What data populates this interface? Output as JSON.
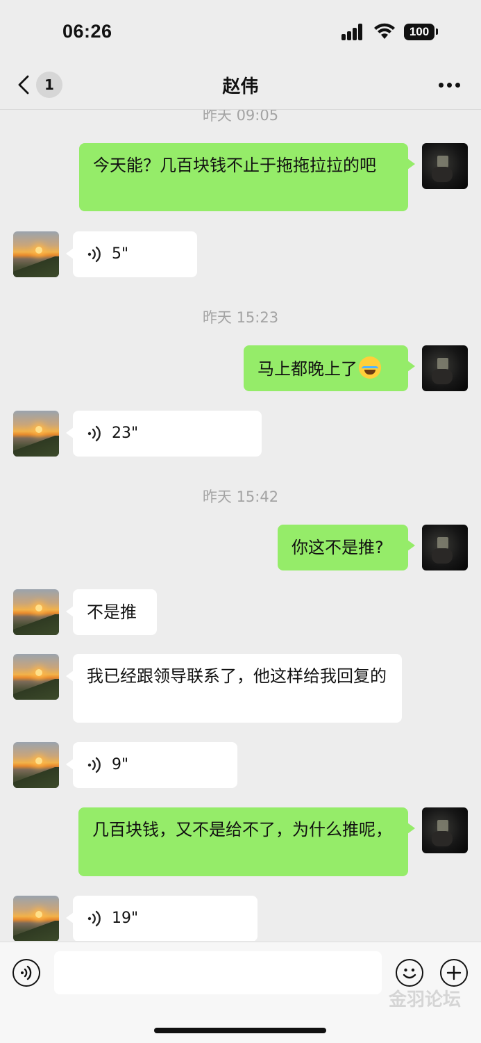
{
  "status_bar": {
    "time": "06:26",
    "battery": "100"
  },
  "nav": {
    "unread_count": "1",
    "title": "赵伟"
  },
  "timestamps": [
    "昨天 09:05",
    "昨天 15:23",
    "昨天 15:42"
  ],
  "messages": [
    {
      "side": "me",
      "type": "text",
      "text": "今天能？几百块钱不止于拖拖拉拉的吧"
    },
    {
      "side": "them",
      "type": "voice",
      "duration": "5\""
    },
    {
      "side": "me",
      "type": "text",
      "text": "马上都晚上了",
      "emoji": "laughing-tears"
    },
    {
      "side": "them",
      "type": "voice",
      "duration": "23\""
    },
    {
      "side": "me",
      "type": "text",
      "text": "你这不是推?"
    },
    {
      "side": "them",
      "type": "text",
      "text": "不是推"
    },
    {
      "side": "them",
      "type": "text",
      "text": "我已经跟领导联系了，他这样给我回复的"
    },
    {
      "side": "them",
      "type": "voice",
      "duration": "9\""
    },
    {
      "side": "me",
      "type": "text",
      "text": "几百块钱，又不是给不了，为什么推呢，"
    },
    {
      "side": "them",
      "type": "voice",
      "duration": "19\""
    }
  ],
  "input_bar": {
    "voice_icon": "voice-mode-icon",
    "emoji_icon": "emoji-icon",
    "plus_icon": "plus-icon"
  },
  "watermark": "金羽论坛"
}
